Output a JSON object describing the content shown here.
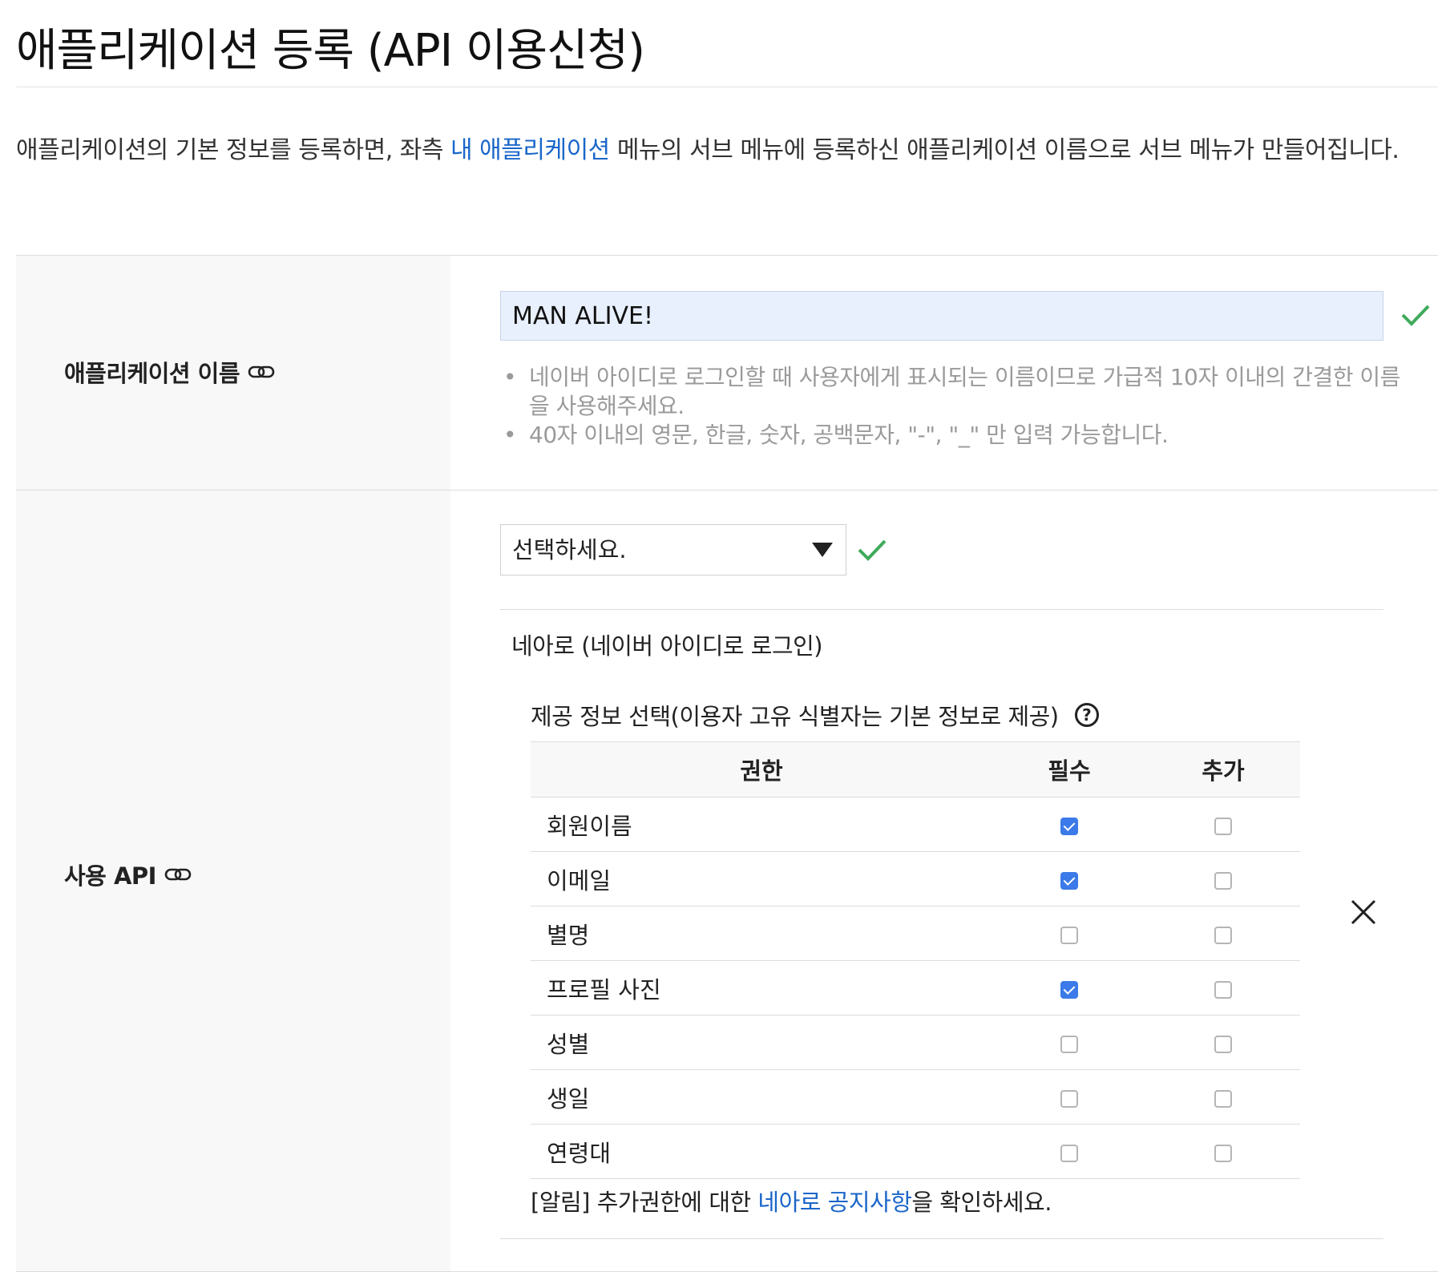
{
  "header": {
    "title": "애플리케이션 등록 (API 이용신청)"
  },
  "intro": {
    "text_before": "애플리케이션의 기본 정보를 등록하면, 좌측 ",
    "link": "내 애플리케이션",
    "text_after": " 메뉴의 서브 메뉴에 등록하신 애플리케이션 이름으로 서브 메뉴가 만들어집니다."
  },
  "app_name": {
    "label": "애플리케이션 이름",
    "value": "MAN ALIVE!",
    "hints": [
      "네이버 아이디로 로그인할 때 사용자에게 표시되는 이름이므로 가급적 10자 이내의 간결한 이름을 사용해주세요.",
      "40자 이내의 영문, 한글, 숫자, 공백문자, \"-\", \"_\" 만 입력 가능합니다."
    ]
  },
  "api": {
    "label": "사용 API",
    "select_value": "선택하세요.",
    "api_name": "네아로 (네이버 아이디로 로그인)",
    "provide_title": "제공 정보 선택(이용자 고유 식별자는 기본 정보로 제공)",
    "help_glyph": "?",
    "columns": [
      "권한",
      "필수",
      "추가"
    ],
    "rows": [
      {
        "name": "회원이름",
        "required": true,
        "additional": false
      },
      {
        "name": "이메일",
        "required": true,
        "additional": false
      },
      {
        "name": "별명",
        "required": false,
        "additional": false
      },
      {
        "name": "프로필 사진",
        "required": true,
        "additional": false
      },
      {
        "name": "성별",
        "required": false,
        "additional": false
      },
      {
        "name": "생일",
        "required": false,
        "additional": false
      },
      {
        "name": "연령대",
        "required": false,
        "additional": false
      }
    ],
    "notice_before": "[알림] 추가권한에 대한 ",
    "notice_link": "네아로 공지사항",
    "notice_after": "을 확인하세요."
  },
  "colors": {
    "link": "#1a66c9",
    "check": "#3faa5a",
    "checkbox_on": "#3b7ae8",
    "input_bg": "#e8f0fe"
  }
}
